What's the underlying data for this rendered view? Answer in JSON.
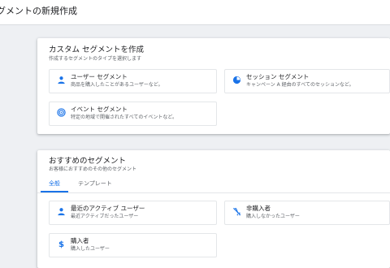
{
  "header": {
    "title": "グメントの新規作成"
  },
  "custom": {
    "title": "カスタム セグメントを作成",
    "subtitle": "作成するセグメントのタイプを選択します",
    "tiles": [
      {
        "label": "ユーザー セグメント",
        "desc": "商品を購入したことがあるユーザーなど。",
        "icon": "person-icon"
      },
      {
        "label": "セッション セグメント",
        "desc": "キャンペーン A 経由のすべてのセッションなど。",
        "icon": "session-icon"
      },
      {
        "label": "イベント セグメント",
        "desc": "特定の地域で開催されたすべてのイベントなど。",
        "icon": "event-icon"
      }
    ]
  },
  "suggested": {
    "title": "おすすめのセグメント",
    "subtitle": "お客様におすすめのその他のセグメント",
    "tabs": [
      {
        "label": "全般",
        "active": true
      },
      {
        "label": "テンプレート",
        "active": false
      }
    ],
    "tiles": [
      {
        "label": "最近のアクティブ ユーザー",
        "desc": "最近アクティブだったユーザー",
        "icon": "person-icon"
      },
      {
        "label": "非購入者",
        "desc": "購入しなかったユーザー",
        "icon": "no-purchase-icon"
      },
      {
        "label": "購入者",
        "desc": "購入したユーザー",
        "icon": "dollar-icon"
      }
    ]
  },
  "colors": {
    "accent": "#1a73e8",
    "background": "#eef0f3",
    "card": "#ffffff"
  }
}
